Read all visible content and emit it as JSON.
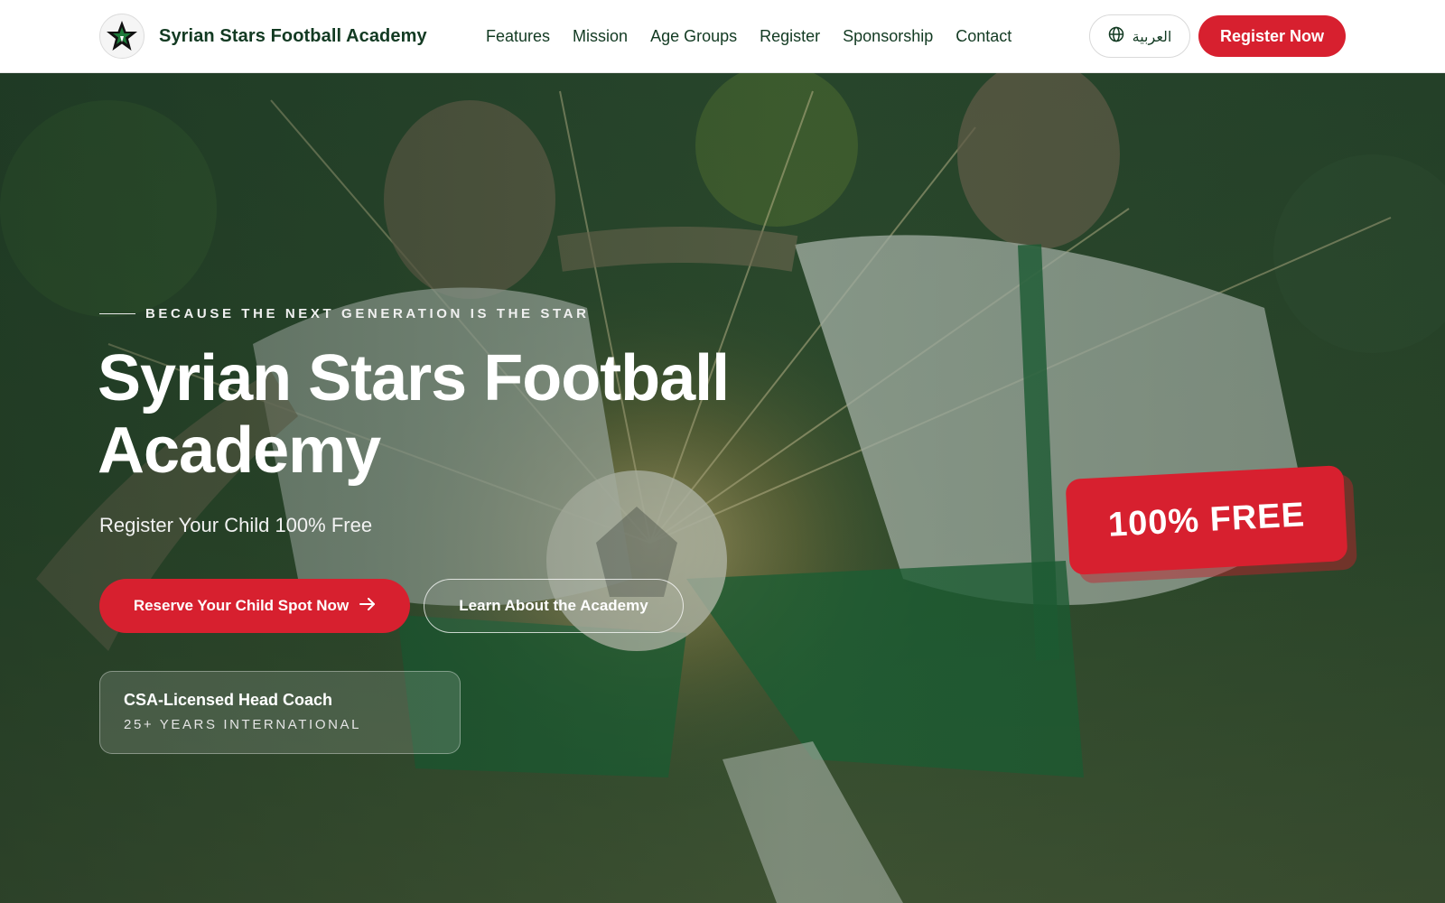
{
  "header": {
    "brand": "Syrian Stars Football Academy",
    "nav": [
      "Features",
      "Mission",
      "Age Groups",
      "Register",
      "Sponsorship",
      "Contact"
    ],
    "language_label": "العربية",
    "register_label": "Register Now"
  },
  "hero": {
    "eyebrow": "BECAUSE THE NEXT GENERATION IS THE STAR",
    "title_line1": "Syrian Stars Football",
    "title_line2": "Academy",
    "subtitle": "Register Your Child 100% Free",
    "primary_cta": "Reserve Your Child Spot Now",
    "secondary_cta": "Learn About the Academy",
    "coach_card": {
      "title": "CSA-Licensed Head Coach",
      "subtitle": "25+ YEARS INTERNATIONAL"
    },
    "free_badge": "100% FREE"
  },
  "colors": {
    "brand_red": "#d7202f",
    "brand_green": "#123a22",
    "header_bg": "#ffffff"
  },
  "icons": {
    "logo": "star-logo-icon",
    "language": "globe-icon",
    "cta_arrow": "arrow-right-icon"
  }
}
